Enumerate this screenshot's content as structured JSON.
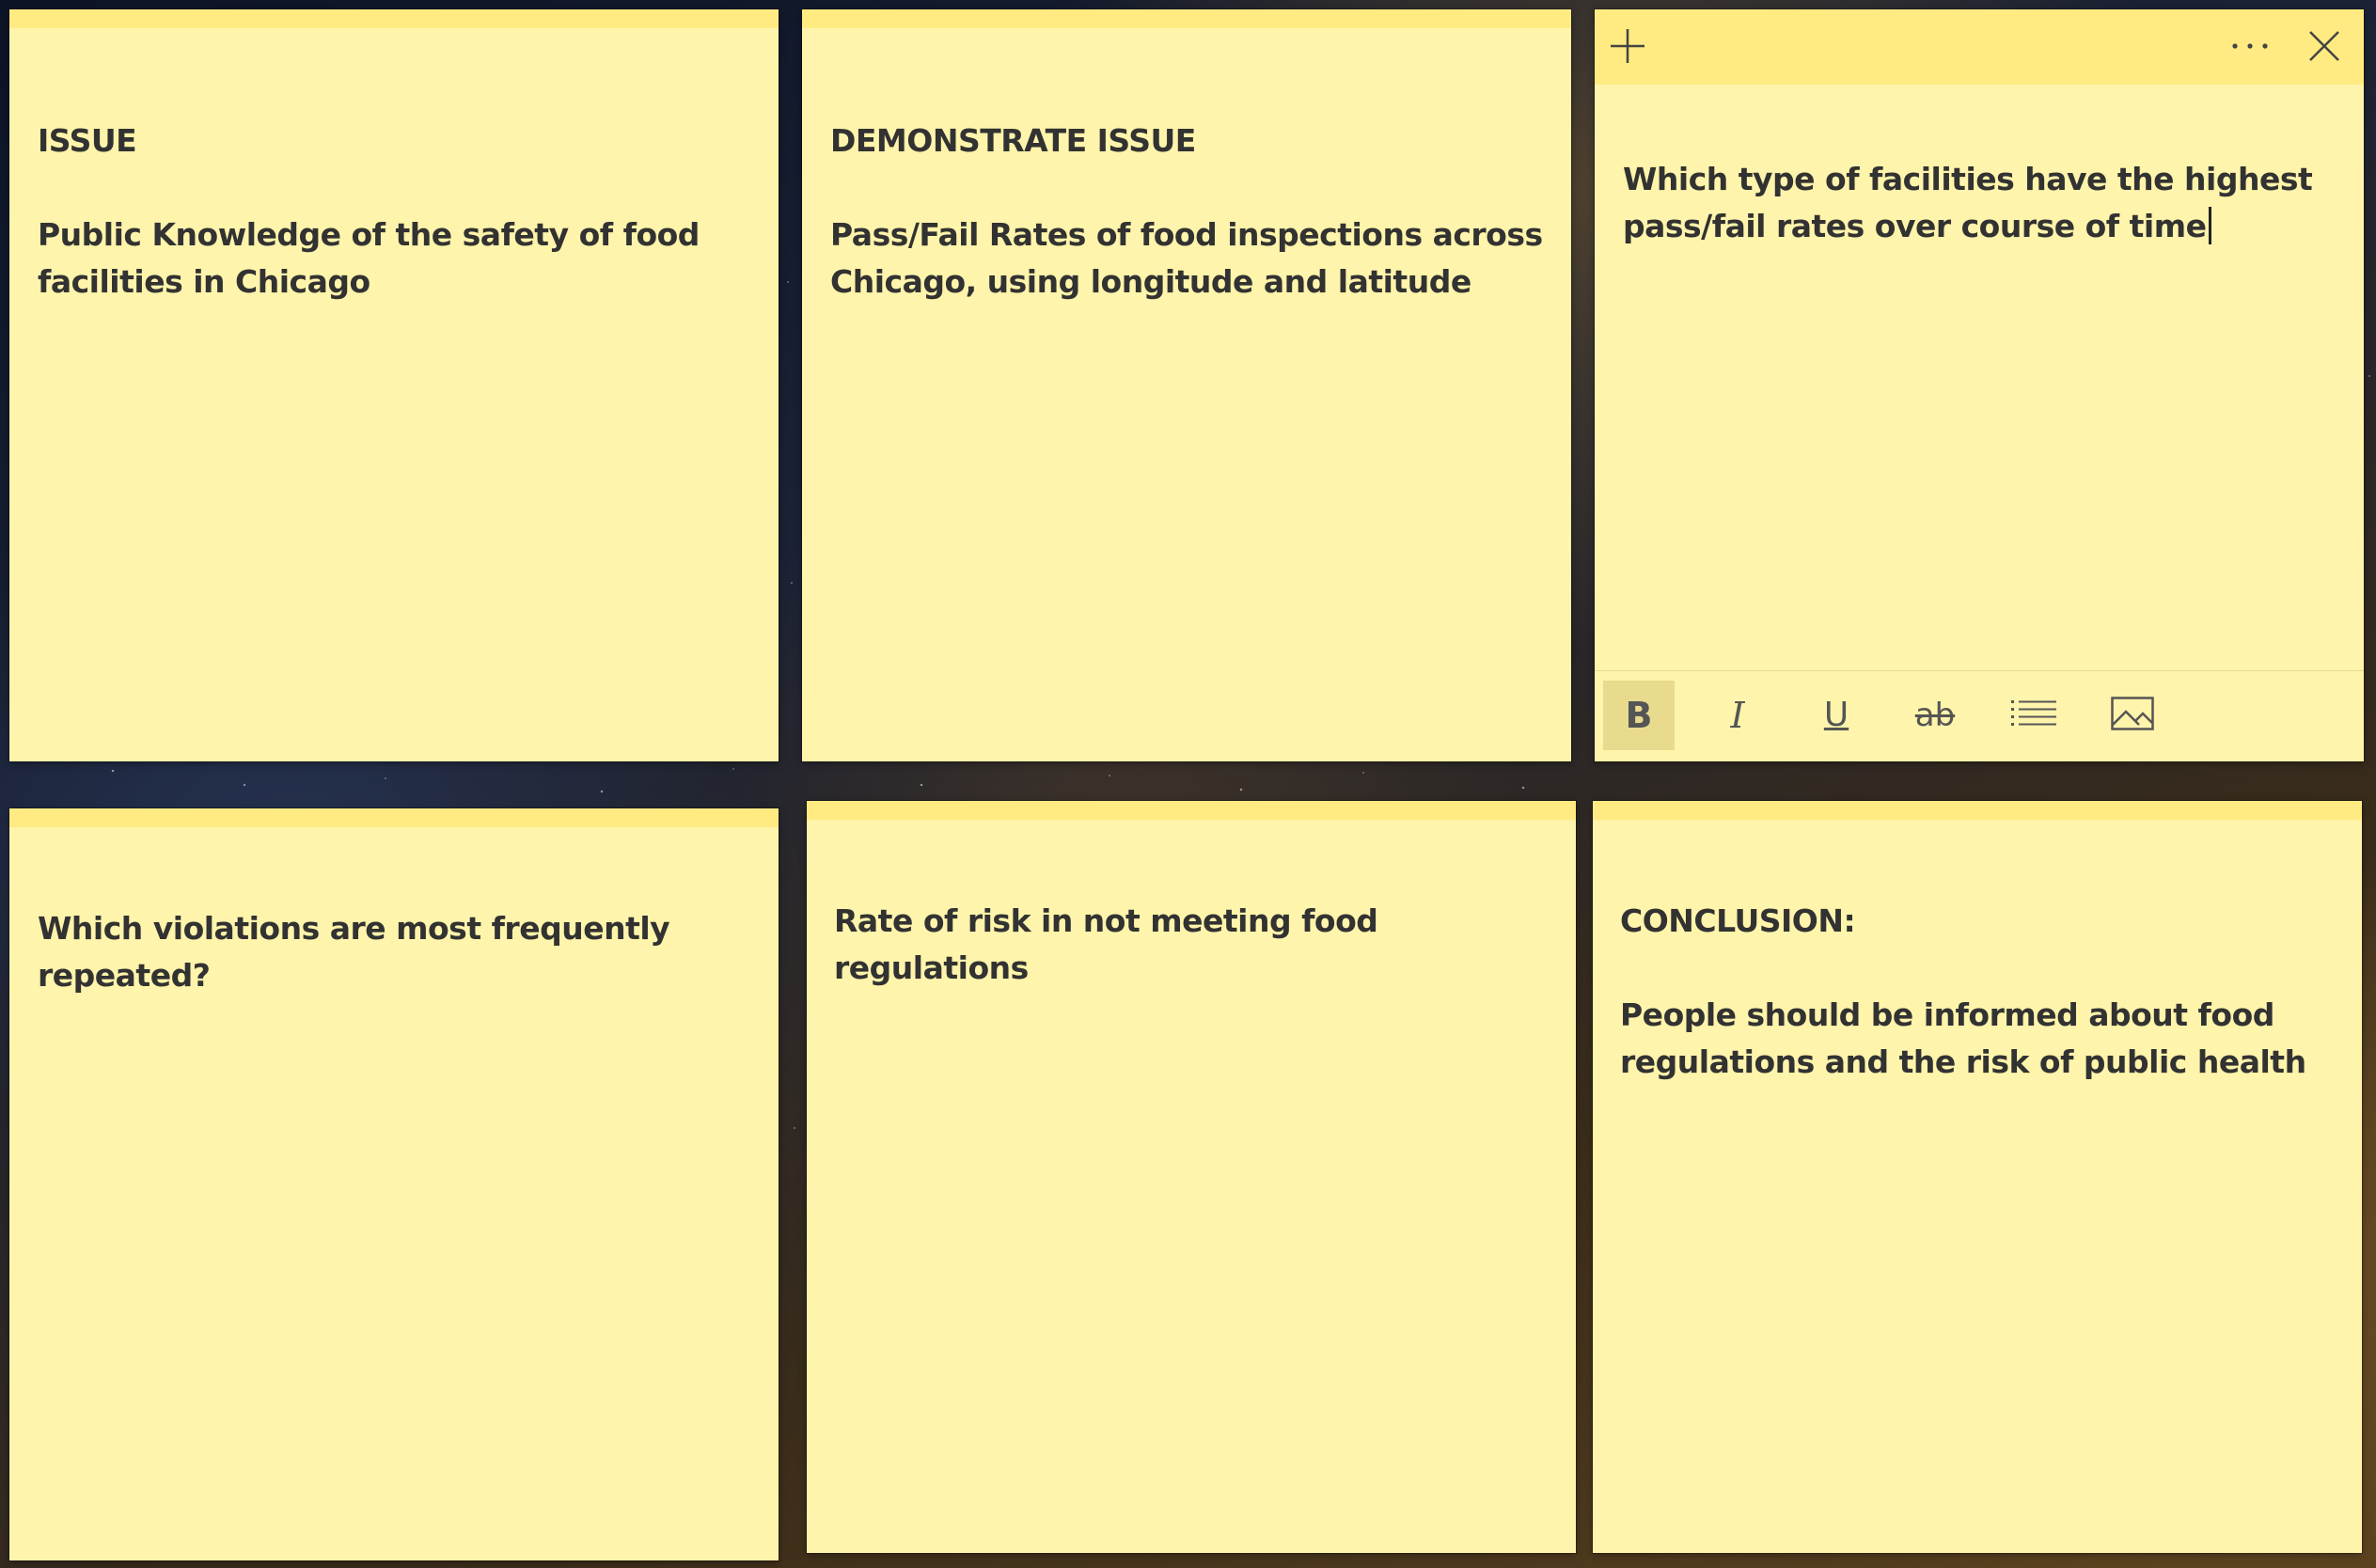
{
  "notes": [
    {
      "heading": "ISSUE",
      "body": "Public Knowledge of the safety of food facilities in Chicago"
    },
    {
      "heading": "DEMONSTRATE ISSUE",
      "body": "Pass/Fail Rates of food inspections across Chicago, using longitude and latitude"
    },
    {
      "heading": "",
      "body": "Which type of facilities have the highest pass/fail rates over course of time"
    },
    {
      "heading": "",
      "body": "Which violations are most frequently repeated?"
    },
    {
      "heading": "",
      "body": "Rate of risk in not meeting food regulations"
    },
    {
      "heading": "CONCLUSION:",
      "body": "People should be informed about food regulations and the risk of public health"
    }
  ],
  "active_note": {
    "header_buttons": {
      "new_note_icon": "plus-icon",
      "menu_icon": "more-icon",
      "close_icon": "close-icon"
    },
    "toolbar": {
      "bold_label": "B",
      "italic_label": "I",
      "underline_label": "U",
      "strikethrough_label": "ab",
      "bold_active": true,
      "list_icon": "bullet-list-icon",
      "image_icon": "image-icon"
    }
  },
  "colors": {
    "note_background": "#fff4ab",
    "note_header": "#ffeb81",
    "text": "#323232",
    "toolbar_active": "#e8db8e"
  }
}
